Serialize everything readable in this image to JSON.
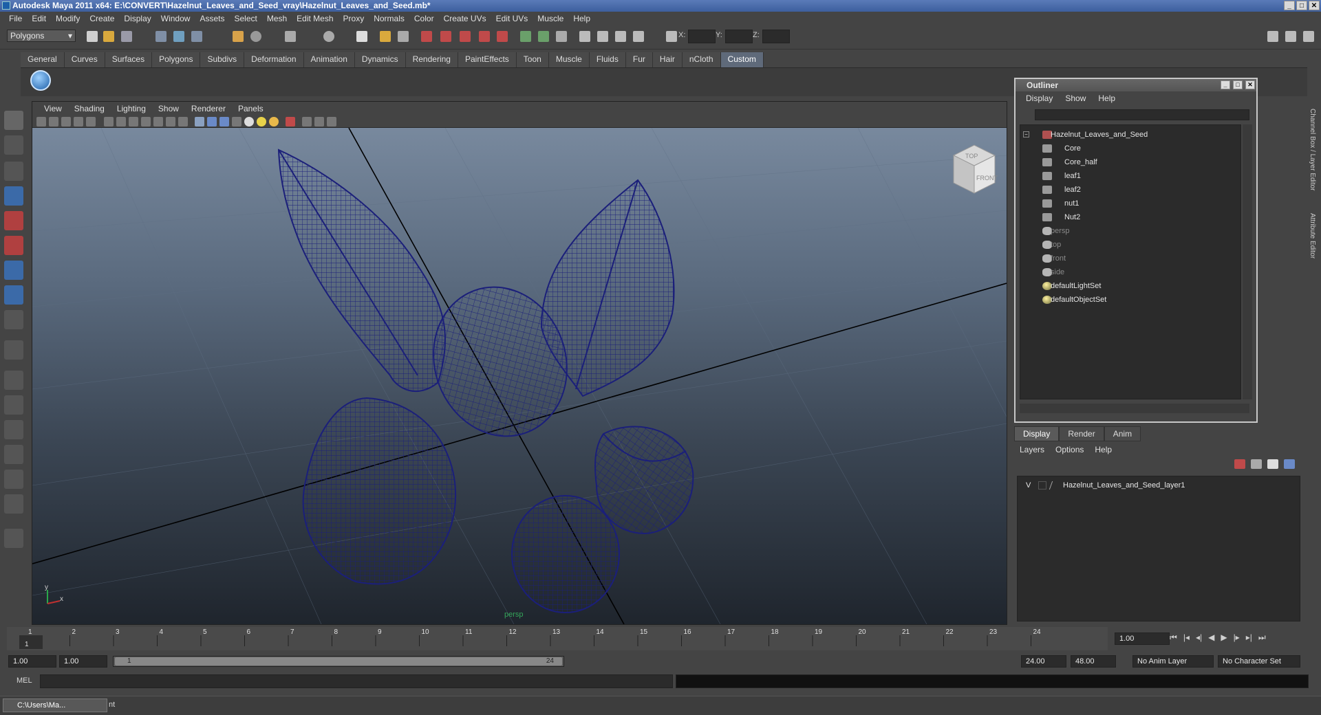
{
  "window": {
    "title": "Autodesk Maya 2011 x64: E:\\CONVERT\\Hazelnut_Leaves_and_Seed_vray\\Hazelnut_Leaves_and_Seed.mb*"
  },
  "menubar": [
    "File",
    "Edit",
    "Modify",
    "Create",
    "Display",
    "Window",
    "Assets",
    "Select",
    "Mesh",
    "Edit Mesh",
    "Proxy",
    "Normals",
    "Color",
    "Create UVs",
    "Edit UVs",
    "Muscle",
    "Help"
  ],
  "statusline": {
    "mode": "Polygons",
    "x_label": "X:",
    "y_label": "Y:",
    "z_label": "Z:"
  },
  "shelf": {
    "tabs": [
      "General",
      "Curves",
      "Surfaces",
      "Polygons",
      "Subdivs",
      "Deformation",
      "Animation",
      "Dynamics",
      "Rendering",
      "PaintEffects",
      "Toon",
      "Muscle",
      "Fluids",
      "Fur",
      "Hair",
      "nCloth",
      "Custom"
    ],
    "active_tab": "Custom"
  },
  "viewport": {
    "menu": [
      "View",
      "Shading",
      "Lighting",
      "Show",
      "Renderer",
      "Panels"
    ],
    "camera": "persp",
    "viewcube_top": "TOP",
    "viewcube_front": "FRONT",
    "axis_y": "y",
    "axis_x": "x"
  },
  "outliner": {
    "title": "Outliner",
    "menu": [
      "Display",
      "Show",
      "Help"
    ],
    "items": [
      {
        "label": "Hazelnut_Leaves_and_Seed",
        "depth": 0,
        "dim": false,
        "icon": "group-icon"
      },
      {
        "label": "Core",
        "depth": 1,
        "dim": false,
        "icon": "mesh-icon"
      },
      {
        "label": "Core_half",
        "depth": 1,
        "dim": false,
        "icon": "mesh-icon"
      },
      {
        "label": "leaf1",
        "depth": 1,
        "dim": false,
        "icon": "mesh-icon"
      },
      {
        "label": "leaf2",
        "depth": 1,
        "dim": false,
        "icon": "mesh-icon"
      },
      {
        "label": "nut1",
        "depth": 1,
        "dim": false,
        "icon": "mesh-icon"
      },
      {
        "label": "Nut2",
        "depth": 1,
        "dim": false,
        "icon": "mesh-icon"
      },
      {
        "label": "persp",
        "depth": 0,
        "dim": true,
        "icon": "camera-icon"
      },
      {
        "label": "top",
        "depth": 0,
        "dim": true,
        "icon": "camera-icon"
      },
      {
        "label": "front",
        "depth": 0,
        "dim": true,
        "icon": "camera-icon"
      },
      {
        "label": "side",
        "depth": 0,
        "dim": true,
        "icon": "camera-icon"
      },
      {
        "label": "defaultLightSet",
        "depth": 0,
        "dim": false,
        "icon": "set-icon"
      },
      {
        "label": "defaultObjectSet",
        "depth": 0,
        "dim": false,
        "icon": "set-icon"
      }
    ]
  },
  "layers": {
    "tabs": [
      "Display",
      "Render",
      "Anim"
    ],
    "active_tab": "Display",
    "menu": [
      "Layers",
      "Options",
      "Help"
    ],
    "rows": [
      {
        "visible": "V",
        "name": "Hazelnut_Leaves_and_Seed_layer1"
      }
    ]
  },
  "right_strip": {
    "channel_box": "Channel Box / Layer Editor",
    "attribute_editor": "Attribute Editor"
  },
  "timeline": {
    "ticks": [
      "1",
      "2",
      "3",
      "4",
      "5",
      "6",
      "7",
      "8",
      "9",
      "10",
      "11",
      "12",
      "13",
      "14",
      "15",
      "16",
      "17",
      "18",
      "19",
      "20",
      "21",
      "22",
      "23",
      "24"
    ],
    "current_frame_marker": "1",
    "current_time": "1.00"
  },
  "range": {
    "start": "1.00",
    "playback_start": "1.00",
    "handle_start": "1",
    "handle_end": "24",
    "playback_end": "24.00",
    "end": "48.00",
    "anim_layer": "No Anim Layer",
    "character_set": "No Character Set"
  },
  "mel": {
    "label": "MEL"
  },
  "taskbar": {
    "item": "C:\\Users\\Ma...",
    "suffix": "nt"
  },
  "colors": {
    "wire": "#1b1f7a",
    "accent": "#5f6a7a"
  }
}
